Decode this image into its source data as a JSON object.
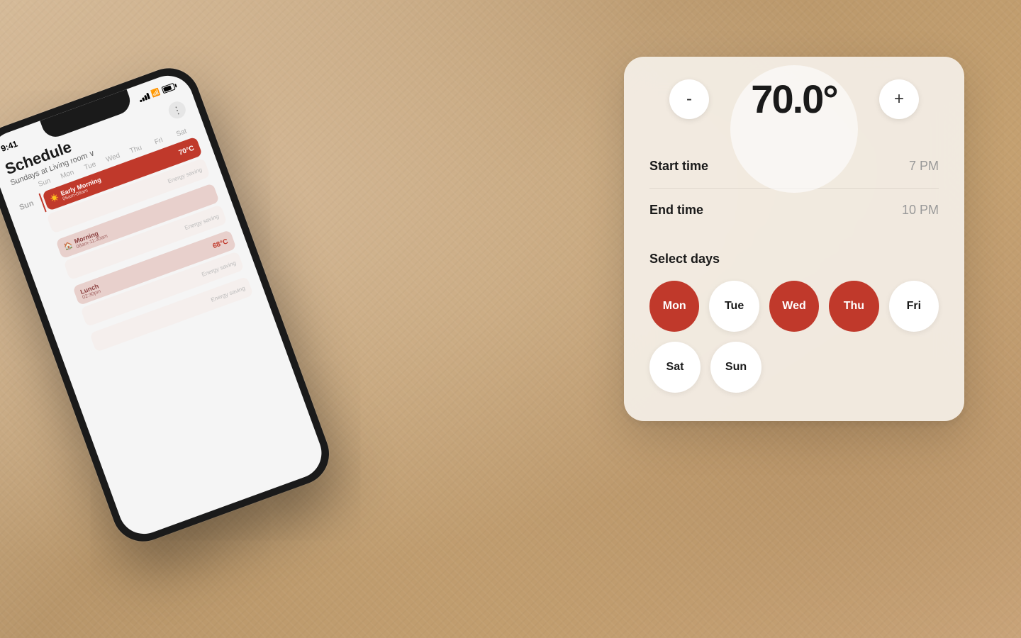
{
  "background": {
    "color": "#c8a882"
  },
  "phone": {
    "status_time": "9:41",
    "subtitle": "Sundays at Living room ∨",
    "title": "Schedule",
    "more_btn": "⋮",
    "day_headers": [
      "Sun",
      "Mon",
      "Tue",
      "Wed",
      "Thu",
      "Fri",
      "Sat"
    ],
    "sections": [
      {
        "day": "Sun",
        "blocks": [
          {
            "name": "Early Morning",
            "time": "06am-08am",
            "icon": "☀",
            "type": "pink"
          },
          {
            "name": "Morning",
            "time": "08am-11:30am",
            "icon": "🏠",
            "type": "pink"
          },
          {
            "name": "Lunch",
            "time": "02:30pm",
            "icon": "",
            "type": "red",
            "temp": "68°C"
          }
        ],
        "energy_labels": [
          "Energy saving",
          "Energy saving",
          "Energy saving",
          "Energy saving"
        ]
      }
    ]
  },
  "panel": {
    "temperature": {
      "value": "70.0°",
      "decrease_btn": "-",
      "increase_btn": "+"
    },
    "start_time": {
      "label": "Start time",
      "value": "7 PM"
    },
    "end_time": {
      "label": "End time",
      "value": "10 PM"
    },
    "select_days": {
      "label": "Select days",
      "days": [
        {
          "label": "Mon",
          "selected": true
        },
        {
          "label": "Tue",
          "selected": false
        },
        {
          "label": "Wed",
          "selected": true
        },
        {
          "label": "Thu",
          "selected": true
        },
        {
          "label": "Fri",
          "selected": false
        },
        {
          "label": "Sat",
          "selected": false
        },
        {
          "label": "Sun",
          "selected": false
        }
      ]
    }
  },
  "colors": {
    "accent_red": "#c0392b",
    "panel_bg": "rgba(245,240,232,0.92)",
    "selected_day_bg": "#c0392b",
    "unselected_day_bg": "#ffffff"
  }
}
